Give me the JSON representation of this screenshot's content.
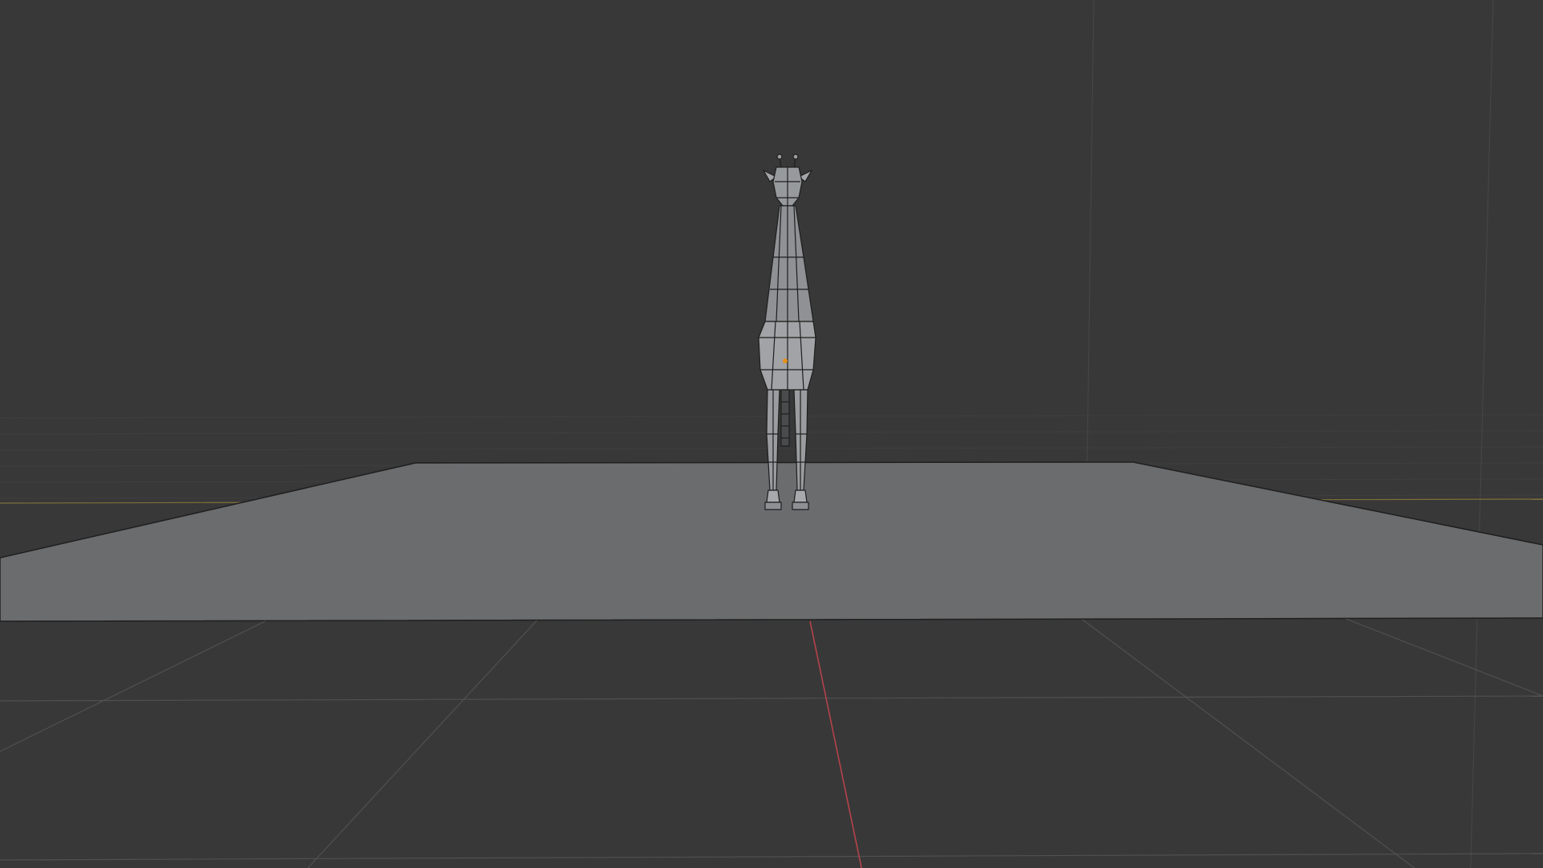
{
  "viewport": {
    "background_color": "#383838",
    "grid_line_color": "#4a4a4a",
    "x_axis_color": "#c0454a",
    "y_axis_color": "#8a7a3a",
    "ground_plane_color": "#6b6c6e",
    "mesh_fill_color": "#8f9194",
    "mesh_wire_color": "#1e1e1e",
    "origin_color": "#e8901c"
  },
  "scene": {
    "objects": [
      {
        "type": "plane",
        "icon": "ground-plane"
      },
      {
        "type": "mesh",
        "icon": "giraffe-model"
      }
    ]
  }
}
